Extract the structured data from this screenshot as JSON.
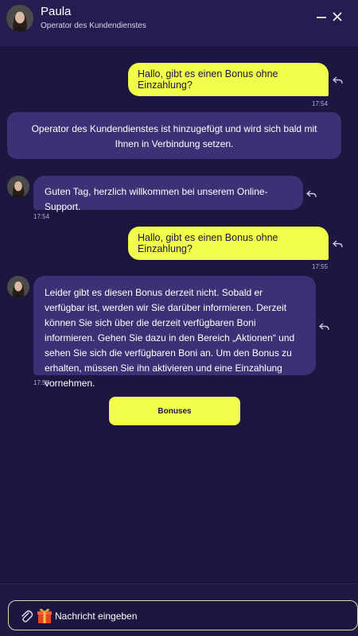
{
  "header": {
    "agent_name": "Paula",
    "agent_role": "Operator des Kundendienstes",
    "minimize_icon": "minimize-icon",
    "close_icon": "close-icon"
  },
  "messages": [
    {
      "type": "outgoing",
      "text": "Hallo, gibt es einen Bonus ohne Einzahlung?",
      "time": "17:54"
    },
    {
      "type": "system",
      "text": "Operator des Kundendienstes ist hinzugefügt und wird sich bald mit Ihnen in Verbindung setzen."
    },
    {
      "type": "incoming",
      "text": "Guten Tag, herzlich willkommen bei unserem Online-Support.",
      "time": "17:54"
    },
    {
      "type": "outgoing",
      "text": "Hallo, gibt es einen Bonus ohne Einzahlung?",
      "time": "17:55"
    },
    {
      "type": "incoming",
      "text": "Leider gibt es diesen Bonus derzeit nicht. Sobald er verfügbar ist, werden wir Sie darüber informieren. Derzeit können Sie sich über die derzeit verfügbaren Boni informieren. Gehen Sie dazu in den Bereich „Aktionen“ und sehen Sie sich die verfügbaren Boni an. Um den Bonus zu erhalten, müssen Sie ihn aktivieren und eine Einzahlung vornehmen.",
      "time": "17:55"
    }
  ],
  "quick_reply": {
    "label": "Bonuses"
  },
  "composer": {
    "placeholder": "Nachricht eingeben",
    "attach_icon": "paperclip-icon",
    "gift_icon": "gift-icon"
  },
  "colors": {
    "background": "#1c1740",
    "header": "#241d50",
    "incoming_bubble": "#3a3275",
    "outgoing_bubble": "#f2ff4a"
  }
}
